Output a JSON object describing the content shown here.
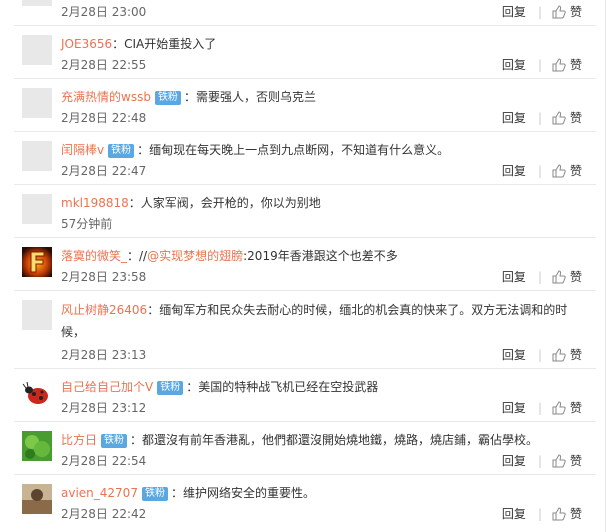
{
  "actions": {
    "reply_label": "回复",
    "like_label": "赞"
  },
  "comments": [
    {
      "user": "",
      "badge": "",
      "text": "",
      "time": "2月28日 23:00"
    },
    {
      "user": "JOE3656",
      "badge": "",
      "text": "：CIA开始重投入了",
      "time": "2月28日 22:55"
    },
    {
      "user": "充满热情的wssb",
      "badge": "铁粉",
      "text": "：需要强人，否则乌克兰",
      "time": "2月28日 22:48"
    },
    {
      "user": "闰隔棒v",
      "badge": "铁粉",
      "text": "：缅甸现在每天晚上一点到九点断网，不知道有什么意义。",
      "time": "2月28日 22:47"
    },
    {
      "user": "mkl198818",
      "badge": "",
      "text": "：人家军阀，会开枪的，你以为别地",
      "time": "57分钟前"
    },
    {
      "user": "落寞的微笑_",
      "badge": "",
      "text_pre": "：//",
      "mention": "@实现梦想的翅膀",
      "text": ":2019年香港跟这个也差不多",
      "time": "2月28日 23:58"
    },
    {
      "user": "风止树静26406",
      "badge": "",
      "text": "：缅甸军方和民众失去耐心的时候，缅北的机会真的快来了。双方无法调和的时候，",
      "time": "2月28日 23:13"
    },
    {
      "user": "自己给自己加个V",
      "badge": "铁粉",
      "text": "：美国的特种战飞机已经在空投武器",
      "time": "2月28日 23:12"
    },
    {
      "user": "比方日",
      "badge": "铁粉",
      "text": "：都還沒有前年香港亂，他們都還沒開始燒地鐵，燒路，燒店鋪，霸佔學校。",
      "time": "2月28日 22:54"
    },
    {
      "user": "avien_42707",
      "badge": "铁粉",
      "text": "：维护网络安全的重要性。",
      "time": "2月28日 22:42"
    }
  ]
}
